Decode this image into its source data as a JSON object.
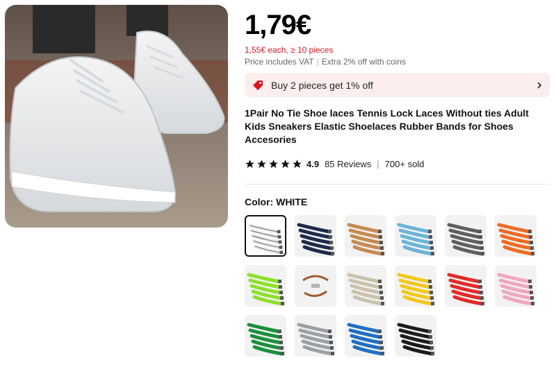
{
  "product": {
    "price": "1,79€",
    "bulk_price": "1,55€ each, ≥ 10 pieces",
    "vat_text": "Price includes VAT",
    "coins_text": "Extra 2% off with coins",
    "promo_text": "Buy 2 pieces get 1% off",
    "title": "1Pair No Tie Shoe laces Tennis Lock Laces Without ties Adult Kids Sneakers Elastic Shoelaces Rubber Bands for Shoes Accesories",
    "rating": "4.9",
    "reviews": "85 Reviews",
    "sold": "700+ sold",
    "stars": 5
  },
  "color": {
    "label": "Color: WHITE",
    "options": [
      {
        "name": "white",
        "hex": "#f4f4f4",
        "selected": true
      },
      {
        "name": "navy",
        "hex": "#1c2b4a"
      },
      {
        "name": "tan",
        "hex": "#c88a52"
      },
      {
        "name": "light-blue",
        "hex": "#6bb3d9"
      },
      {
        "name": "gray",
        "hex": "#5f5f5f"
      },
      {
        "name": "orange",
        "hex": "#f06b22"
      },
      {
        "name": "lime",
        "hex": "#8ee02a"
      },
      {
        "name": "brown-single",
        "hex": "#a0592a"
      },
      {
        "name": "beige",
        "hex": "#c9c2ac"
      },
      {
        "name": "yellow",
        "hex": "#f2c81c"
      },
      {
        "name": "red",
        "hex": "#e22a2a"
      },
      {
        "name": "pink",
        "hex": "#f0a7bd"
      },
      {
        "name": "green",
        "hex": "#1a8f3a"
      },
      {
        "name": "silver",
        "hex": "#9aa0a6"
      },
      {
        "name": "blue",
        "hex": "#1f6fc4"
      },
      {
        "name": "black",
        "hex": "#1b1b1b"
      }
    ]
  },
  "colors": {
    "accent_red": "#e0141e",
    "promo_bg": "#fdeeee"
  }
}
